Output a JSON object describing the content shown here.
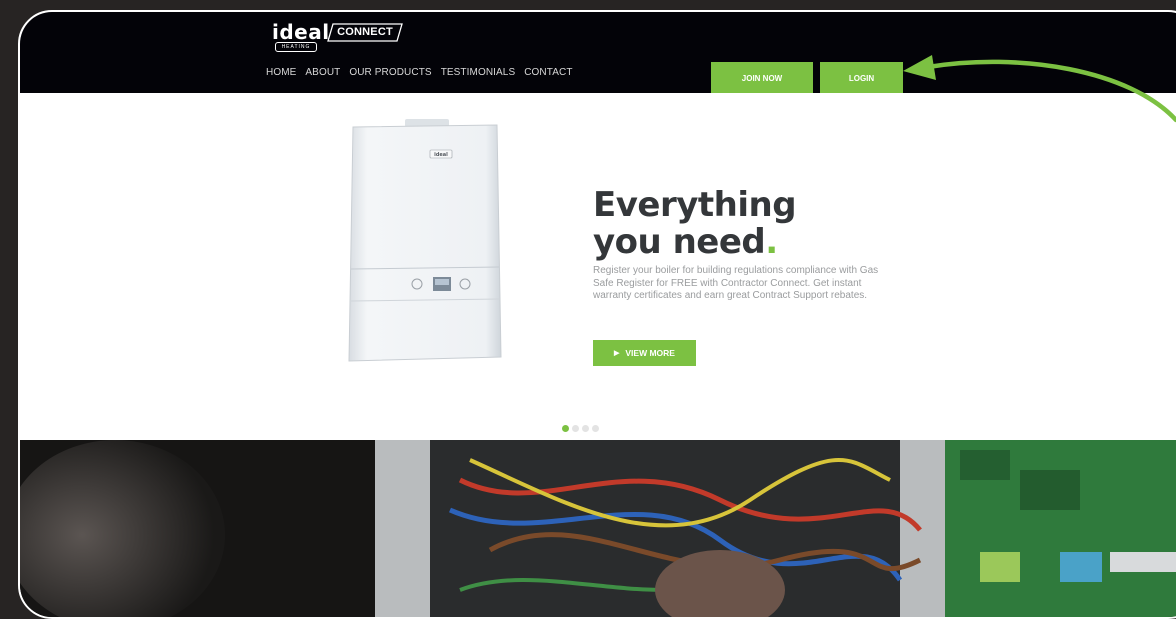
{
  "logo": {
    "brand": "ideal",
    "sub": "HEATING",
    "product": "CONNECT"
  },
  "nav": [
    {
      "label": "HOME",
      "name": "nav-home"
    },
    {
      "label": "ABOUT",
      "name": "nav-about"
    },
    {
      "label": "OUR PRODUCTS",
      "name": "nav-our-products"
    },
    {
      "label": "TESTIMONIALS",
      "name": "nav-testimonials"
    },
    {
      "label": "CONTACT",
      "name": "nav-contact"
    }
  ],
  "header": {
    "join_label": "JOIN NOW",
    "login_label": "LOGIN"
  },
  "hero": {
    "headline_line1": "Everything",
    "headline_line2": "you need",
    "headline_dot": ".",
    "body": "Register your boiler for building regulations compliance with Gas Safe Register for FREE with Contractor Connect. Get instant warranty certificates and earn great Contract Support rebates.",
    "cta_label": "VIEW MORE",
    "boiler_badge": "ideal",
    "slide_count": 4,
    "active_slide": 1
  },
  "colors": {
    "accent": "#7cc142",
    "header_bg": "#030308",
    "headline": "#34373a",
    "body_text": "#9a9c9e",
    "outer_bg": "#272423"
  },
  "icons": {
    "cta_icon": "play-triangle-icon",
    "annotation": "curved-arrow-icon"
  }
}
